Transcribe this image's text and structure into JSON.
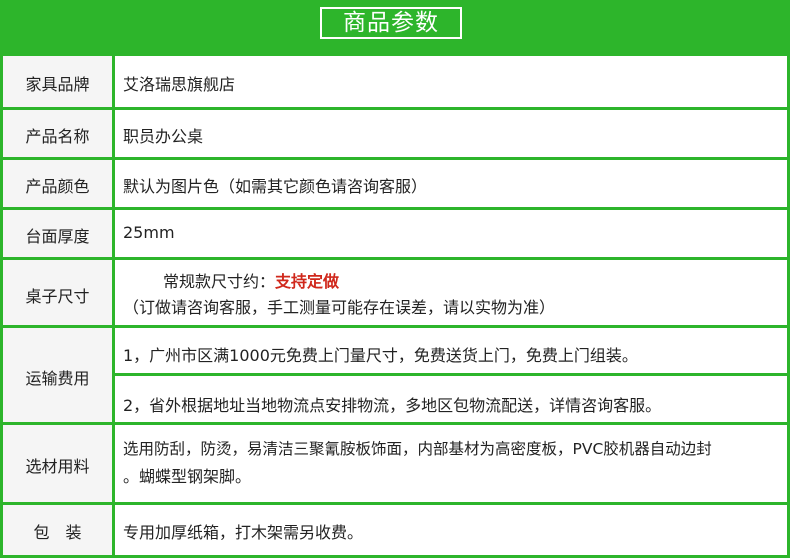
{
  "header": {
    "title": "商品参数"
  },
  "rows": {
    "brand": {
      "label": "家具品牌",
      "value": "艾洛瑞思旗舰店"
    },
    "name": {
      "label": "产品名称",
      "value": "职员办公桌"
    },
    "color": {
      "label": "产品颜色",
      "value": "默认为图片色（如需其它颜色请咨询客服）"
    },
    "thickness": {
      "label": "台面厚度",
      "value": "25mm"
    },
    "size": {
      "label": "桌子尺寸",
      "line1_prefix": "常规款尺寸约：",
      "line1_highlight": "支持定做",
      "line2": "（订做请咨询客服，手工测量可能存在误差，请以实物为准）"
    },
    "shipping": {
      "label": "运输费用",
      "line1": "1，广州市区满1000元免费上门量尺寸，免费送货上门，免费上门组装。",
      "line2": "2，省外根据地址当地物流点安排物流，多地区包物流配送，详情咨询客服。"
    },
    "material": {
      "label": "选材用料",
      "line1": "选用防刮，防烫，易清洁三聚氰胺板饰面，内部基材为高密度板，PVC胶机器自动边封",
      "line2": "。蝴蝶型钢架脚。"
    },
    "packaging": {
      "label": "包　装",
      "value": "专用加厚纸箱，打木架需另收费。"
    }
  },
  "colors": {
    "accent": "#2db52b",
    "highlight": "#d0281c",
    "label_bg": "#f5f5f5"
  }
}
